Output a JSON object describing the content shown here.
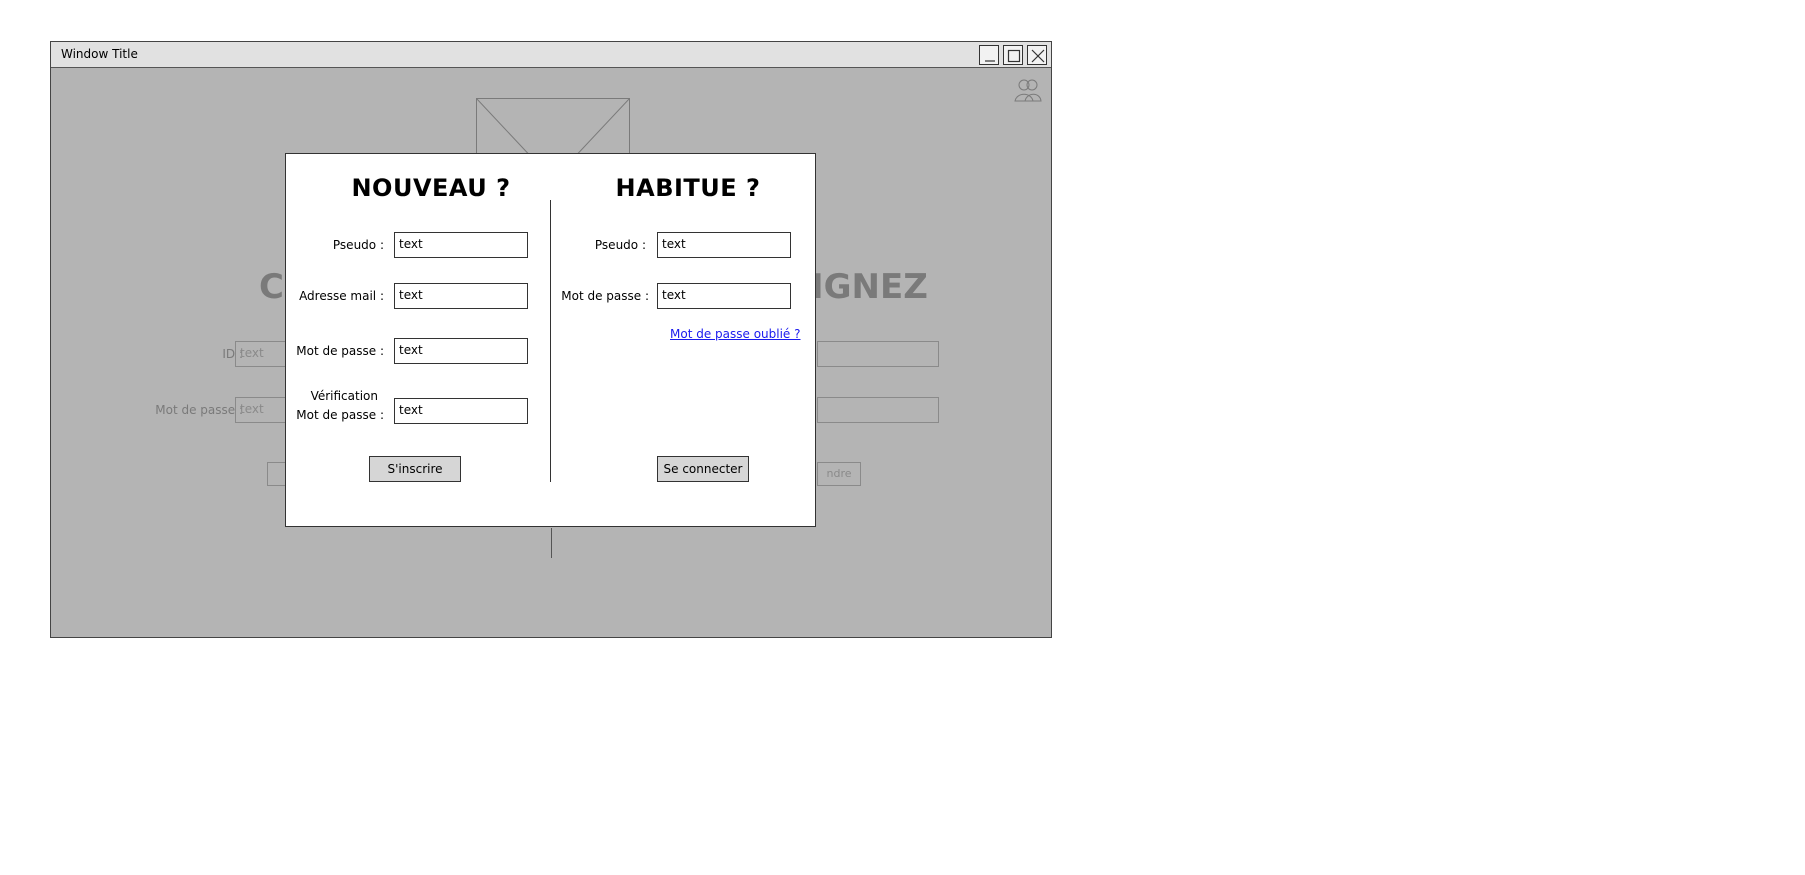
{
  "window": {
    "title": "Window Title"
  },
  "background": {
    "heading_left": "CI",
    "heading_right": "IGNEZ",
    "id_label": "ID :",
    "password_label": "Mot de passe :",
    "id_placeholder": "text",
    "password_placeholder": "text",
    "button_right": "ndre"
  },
  "register": {
    "heading": "NOUVEAU ?",
    "pseudo_label": "Pseudo :",
    "pseudo_value": "text",
    "email_label": "Adresse mail :",
    "email_value": "text",
    "password_label": "Mot de passe :",
    "password_value": "text",
    "verify_label_1": "Vérification",
    "verify_label_2": "Mot de passe :",
    "verify_value": "text",
    "submit_label": "S'inscrire"
  },
  "login": {
    "heading": "HABITUE ?",
    "pseudo_label": "Pseudo :",
    "pseudo_value": "text",
    "password_label": "Mot de passe :",
    "password_value": "text",
    "forgot_link": "Mot de passe oublié ?",
    "submit_label": "Se connecter"
  }
}
